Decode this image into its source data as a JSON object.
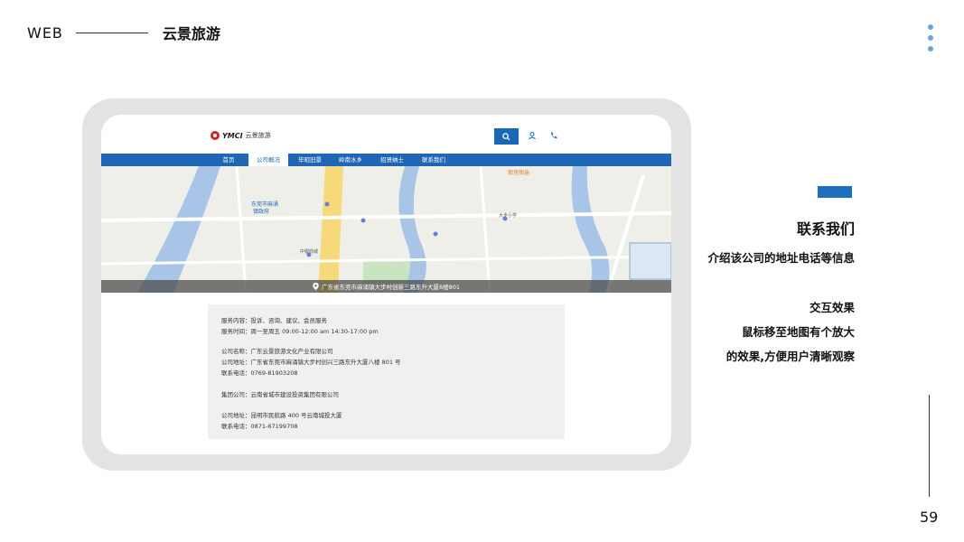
{
  "header": {
    "web_label": "WEB",
    "brand": "云景旅游"
  },
  "site": {
    "logo_text": "YMCI",
    "logo_cn": "云景旅游",
    "nav": [
      "首页",
      "公司概况",
      "毕昭旧景",
      "岭南水乡",
      "招贤纳士",
      "联系我们"
    ],
    "active_nav": "公司概况",
    "map": {
      "address_bar": "广东省东莞市麻涌镇大步村创新三路东升大厦8楼801",
      "labels": [
        "观音阁庙",
        "东莞市麻涌",
        "镇政府",
        "中银商城",
        "东莞市",
        "麻涌镇",
        "大步小学"
      ]
    },
    "info_lines": [
      "服务内容：投诉、咨询、建议、会员服务",
      "服务时间：周一至周五 09:00-12:00 am 14:30-17:00 pm",
      "公司名称：广东云景旅游文化产业有限公司",
      "公司地址：广东省东莞市麻涌镇大步村创兴三路东升大厦八楼 801 号",
      "联系电话：0769-81903208",
      "集团公司：云南省城市建设投资集团有限公司",
      "公司地址：昆明市民航路 400 号云南城投大厦",
      "联系电话：0871-67199708"
    ]
  },
  "right_panel": {
    "title": "联系我们",
    "subtitle": "介绍该公司的地址电话等信息",
    "lines": [
      "交互效果",
      "鼠标移至地图有个放大",
      "的效果,方便用户清晰观察"
    ]
  },
  "page_number": "59",
  "colors": {
    "accent": "#1f6fc0",
    "nav": "#1f67b5",
    "dots": "#6fa3d8",
    "frame": "#e3e3e3"
  }
}
